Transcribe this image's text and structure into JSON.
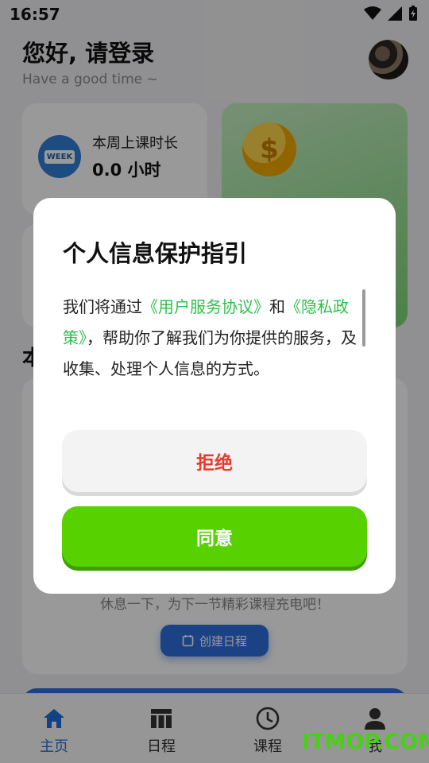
{
  "status_bar": {
    "time": "16:57"
  },
  "header": {
    "title": "您好, 请登录",
    "subtitle": "Have a good time ~"
  },
  "week_card": {
    "icon_text": "WEEK",
    "label": "本周上课时长",
    "value": "0.0 小时"
  },
  "section": {
    "title_partial": "本"
  },
  "schedule_card": {
    "rest_text": "休息一下，为下一节精彩课程充电吧！",
    "create_button": "创建日程"
  },
  "tabbar": {
    "items": [
      {
        "label": "主页",
        "icon": "home-icon",
        "active": true
      },
      {
        "label": "日程",
        "icon": "calendar-grid-icon",
        "active": false
      },
      {
        "label": "课程",
        "icon": "clock-icon",
        "active": false
      },
      {
        "label": "我",
        "icon": "person-icon",
        "active": false
      }
    ]
  },
  "dialog": {
    "title": "个人信息保护指引",
    "body_prefix": "我们将通过",
    "link1": "《用户服务协议》",
    "body_and": "和",
    "link2": "《隐私政策》",
    "body_suffix": "，帮助你了解我们为你提供的服务，及收集、处理个人信息的方式。",
    "reject_label": "拒绝",
    "agree_label": "同意"
  },
  "watermark": "ITMOP.COM",
  "colors": {
    "accent_blue": "#1e6fdc",
    "agree_green": "#57d100",
    "reject_red": "#e63b2e",
    "link_green": "#2fbf4a"
  }
}
